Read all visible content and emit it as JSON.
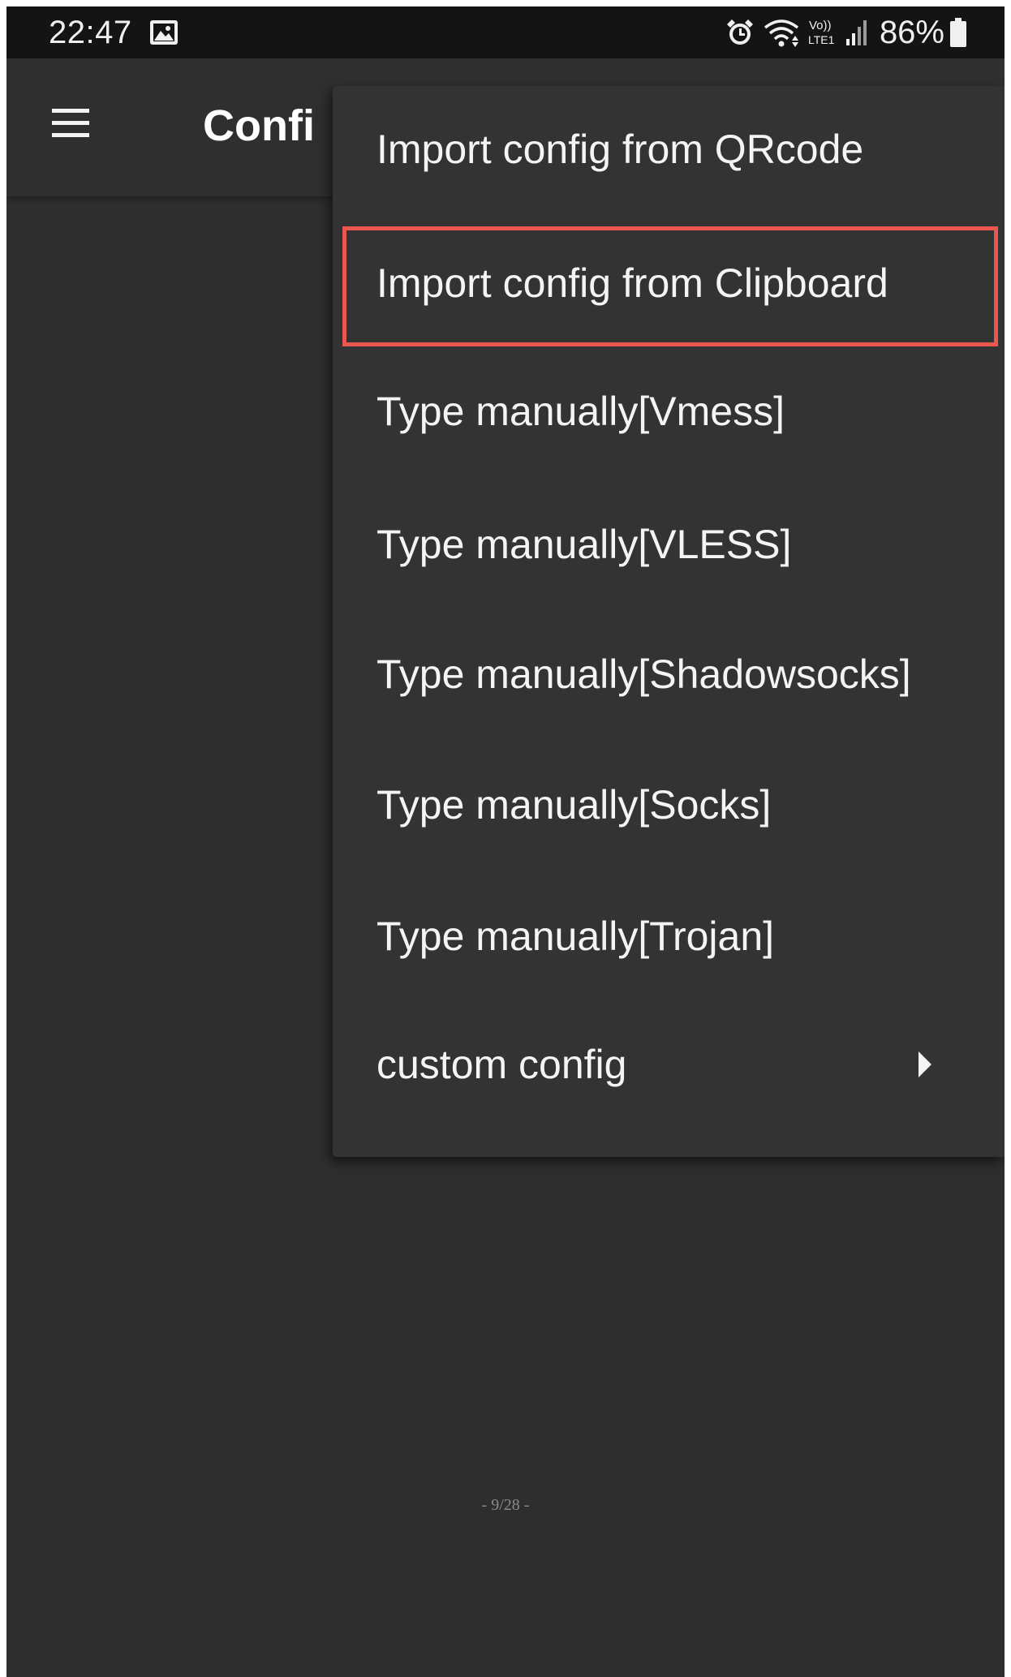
{
  "status_bar": {
    "time": "22:47",
    "battery_percent": "86%",
    "icons": [
      "gallery-icon",
      "alarm-icon",
      "wifi-icon",
      "volte-lte-icon",
      "signal-icon",
      "battery-icon"
    ]
  },
  "app_bar": {
    "title": "Confi",
    "menu_icon": "hamburger-menu-icon"
  },
  "dropdown": {
    "items": [
      {
        "label": "Import config from QRcode",
        "highlighted": false,
        "has_submenu": false
      },
      {
        "label": "Import config from Clipboard",
        "highlighted": true,
        "has_submenu": false
      },
      {
        "label": "Type manually[Vmess]",
        "highlighted": false,
        "has_submenu": false
      },
      {
        "label": "Type manually[VLESS]",
        "highlighted": false,
        "has_submenu": false
      },
      {
        "label": "Type manually[Shadowsocks]",
        "highlighted": false,
        "has_submenu": false
      },
      {
        "label": "Type manually[Socks]",
        "highlighted": false,
        "has_submenu": false
      },
      {
        "label": "Type manually[Trojan]",
        "highlighted": false,
        "has_submenu": false
      },
      {
        "label": "custom config",
        "highlighted": false,
        "has_submenu": true
      }
    ]
  },
  "footer": {
    "page_number": "- 9/28 -"
  },
  "colors": {
    "background": "#2e2e2e",
    "status_bar": "#141414",
    "menu_background": "#333333",
    "highlight_border": "#e9574e",
    "text": "#f4f4f4"
  }
}
